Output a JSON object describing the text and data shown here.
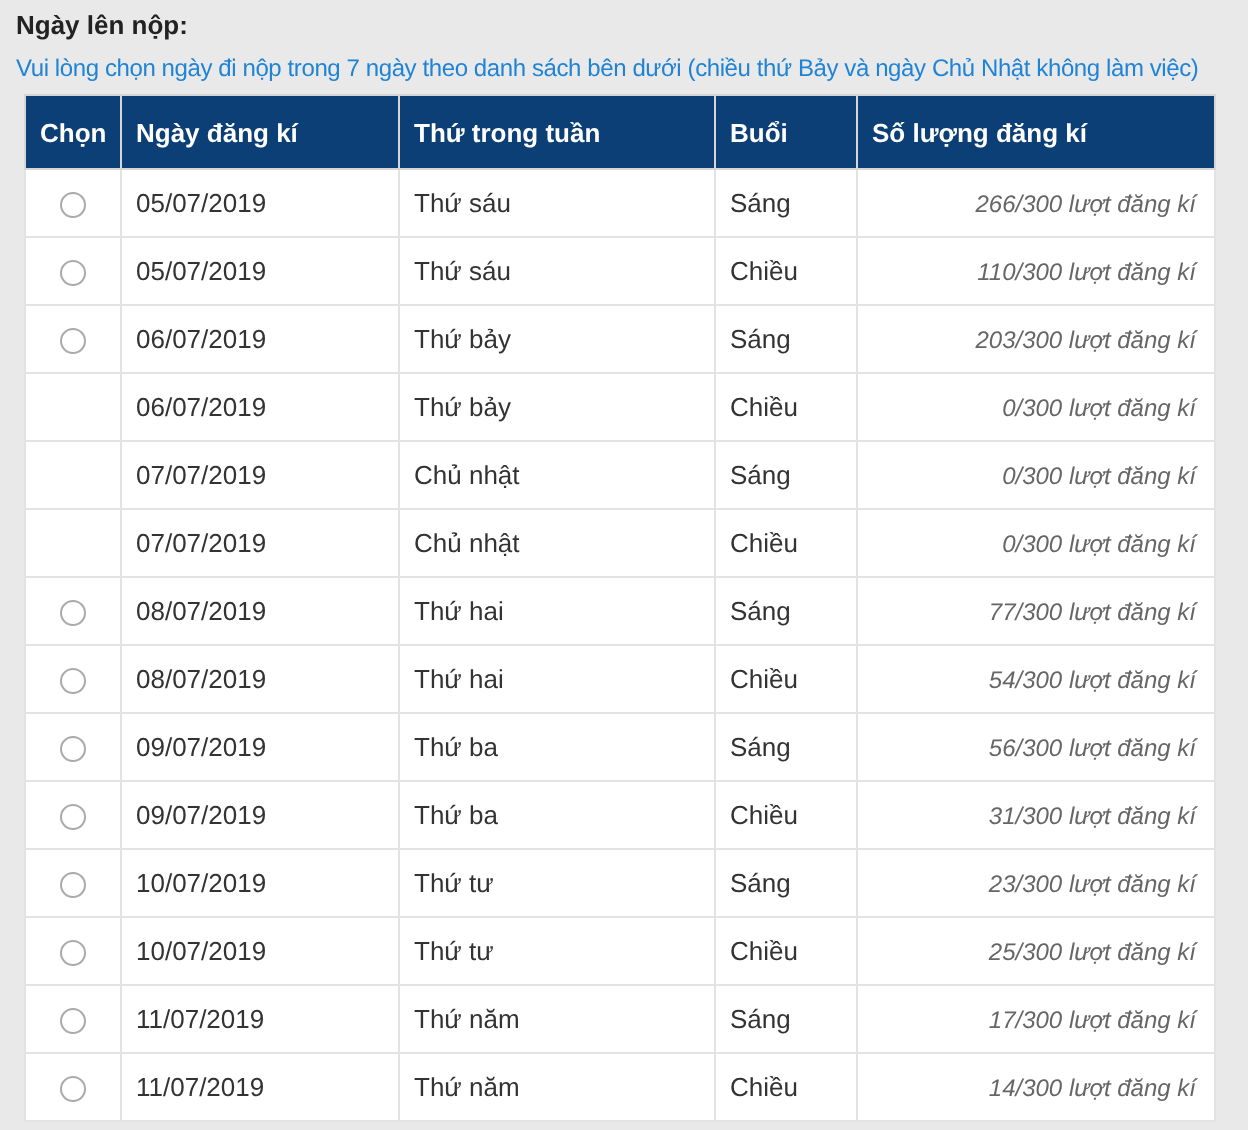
{
  "heading": "Ngày lên nộp:",
  "note": "Vui lòng chọn ngày đi nộp trong 7 ngày theo danh sách bên dưới (chiều thứ Bảy và ngày Chủ Nhật không làm việc)",
  "table": {
    "columns": [
      "Chọn",
      "Ngày đăng kí",
      "Thứ trong tuần",
      "Buổi",
      "Số lượng đăng kí"
    ],
    "rows": [
      {
        "available": true,
        "selected": false,
        "date": "05/07/2019",
        "weekday": "Thứ sáu",
        "session": "Sáng",
        "count": "266/300 lượt đăng kí"
      },
      {
        "available": true,
        "selected": false,
        "date": "05/07/2019",
        "weekday": "Thứ sáu",
        "session": "Chiều",
        "count": "110/300 lượt đăng kí"
      },
      {
        "available": true,
        "selected": false,
        "date": "06/07/2019",
        "weekday": "Thứ bảy",
        "session": "Sáng",
        "count": "203/300 lượt đăng kí"
      },
      {
        "available": false,
        "date": "06/07/2019",
        "weekday": "Thứ bảy",
        "session": "Chiều",
        "count": "0/300 lượt đăng kí"
      },
      {
        "available": false,
        "date": "07/07/2019",
        "weekday": "Chủ nhật",
        "session": "Sáng",
        "count": "0/300 lượt đăng kí"
      },
      {
        "available": false,
        "date": "07/07/2019",
        "weekday": "Chủ nhật",
        "session": "Chiều",
        "count": "0/300 lượt đăng kí"
      },
      {
        "available": true,
        "selected": false,
        "date": "08/07/2019",
        "weekday": "Thứ hai",
        "session": "Sáng",
        "count": "77/300 lượt đăng kí"
      },
      {
        "available": true,
        "selected": false,
        "date": "08/07/2019",
        "weekday": "Thứ hai",
        "session": "Chiều",
        "count": "54/300 lượt đăng kí"
      },
      {
        "available": true,
        "selected": false,
        "date": "09/07/2019",
        "weekday": "Thứ ba",
        "session": "Sáng",
        "count": "56/300 lượt đăng kí"
      },
      {
        "available": true,
        "selected": false,
        "date": "09/07/2019",
        "weekday": "Thứ ba",
        "session": "Chiều",
        "count": "31/300 lượt đăng kí"
      },
      {
        "available": true,
        "selected": false,
        "date": "10/07/2019",
        "weekday": "Thứ tư",
        "session": "Sáng",
        "count": "23/300 lượt đăng kí"
      },
      {
        "available": true,
        "selected": false,
        "date": "10/07/2019",
        "weekday": "Thứ tư",
        "session": "Chiều",
        "count": "25/300 lượt đăng kí"
      },
      {
        "available": true,
        "selected": false,
        "date": "11/07/2019",
        "weekday": "Thứ năm",
        "session": "Sáng",
        "count": "17/300 lượt đăng kí"
      },
      {
        "available": true,
        "selected": false,
        "date": "11/07/2019",
        "weekday": "Thứ năm",
        "session": "Chiều",
        "count": "14/300 lượt đăng kí"
      }
    ]
  }
}
